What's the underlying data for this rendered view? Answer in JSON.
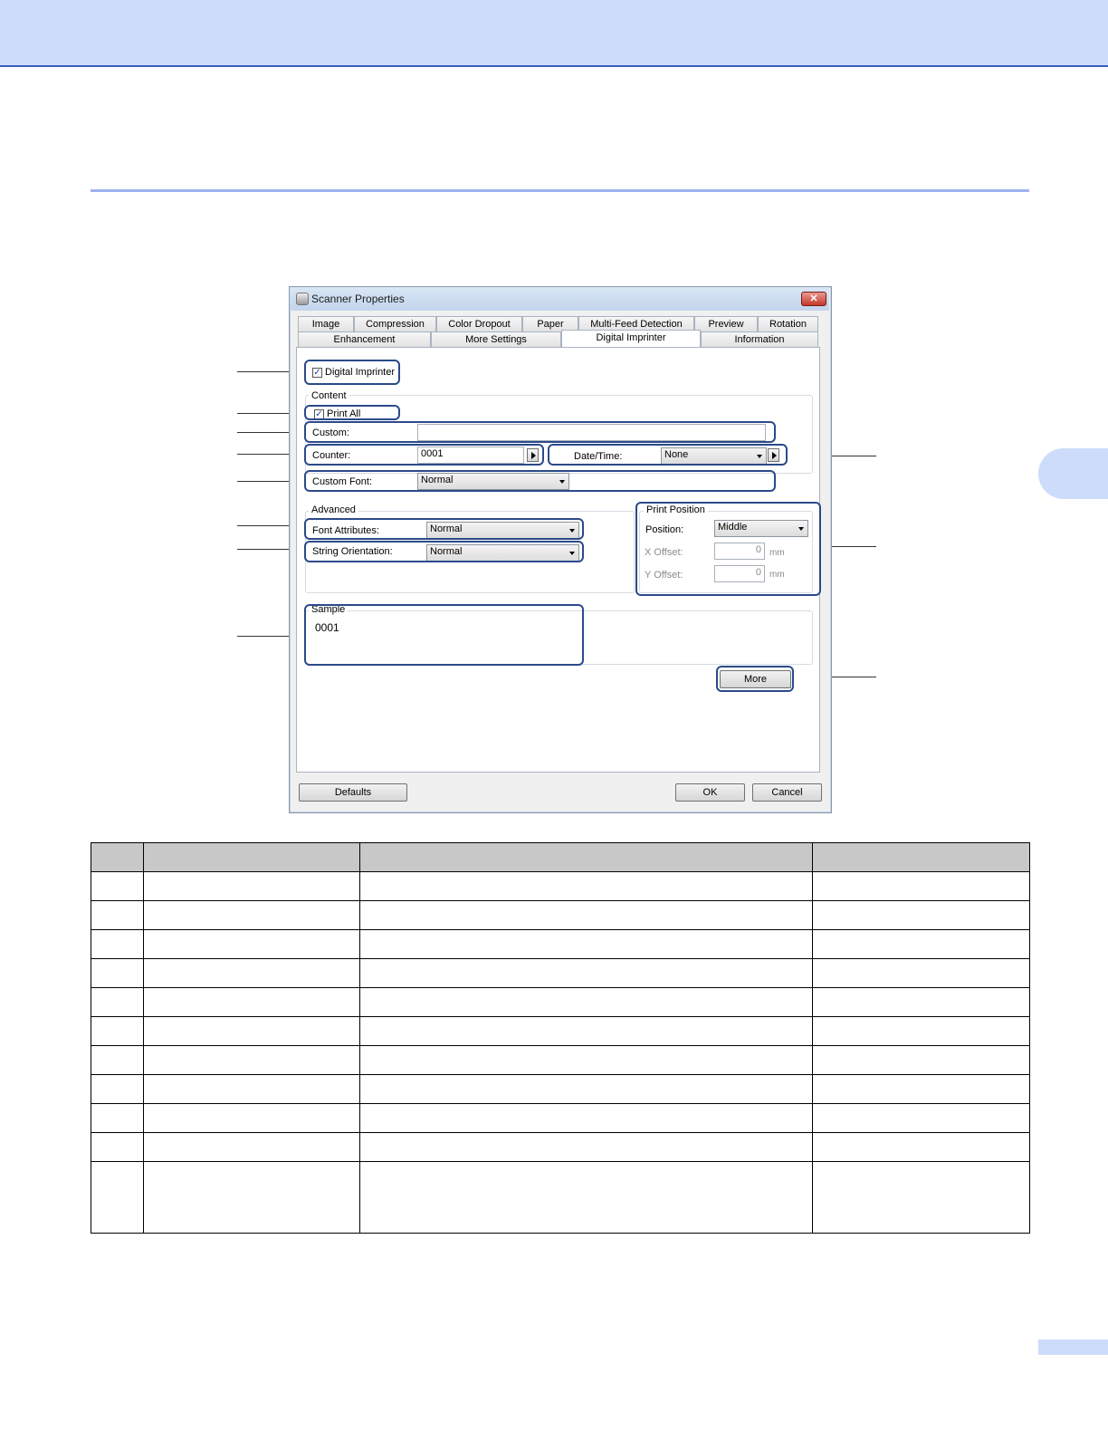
{
  "dialog": {
    "title": "Scanner Properties",
    "close_label": "✕",
    "tabs_row1": [
      "Image",
      "Compression",
      "Color Dropout",
      "Paper",
      "Multi-Feed Detection",
      "Preview",
      "Rotation"
    ],
    "tabs_row2": [
      "Enhancement",
      "More Settings",
      "Digital Imprinter",
      "Information"
    ],
    "active_tab": "Digital Imprinter",
    "digital_imprinter_label": "Digital Imprinter",
    "digital_imprinter_checked": true,
    "content": {
      "group_label": "Content",
      "print_all_label": "Print All",
      "print_all_checked": true,
      "custom_label": "Custom:",
      "custom_value": "",
      "counter_label": "Counter:",
      "counter_value": "0001",
      "datetime_label": "Date/Time:",
      "datetime_value": "None",
      "custom_font_label": "Custom Font:",
      "custom_font_value": "Normal"
    },
    "advanced": {
      "group_label": "Advanced",
      "font_attributes_label": "Font Attributes:",
      "font_attributes_value": "Normal",
      "string_orientation_label": "String Orientation:",
      "string_orientation_value": "Normal"
    },
    "print_position": {
      "group_label": "Print Position",
      "position_label": "Position:",
      "position_value": "Middle",
      "x_offset_label": "X Offset:",
      "x_offset_value": "0",
      "y_offset_label": "Y Offset:",
      "y_offset_value": "0",
      "unit": "mm"
    },
    "sample": {
      "group_label": "Sample",
      "text": "0001"
    },
    "more_button": "More",
    "defaults_button": "Defaults",
    "ok_button": "OK",
    "cancel_button": "Cancel"
  },
  "table": {
    "rows": 12
  }
}
